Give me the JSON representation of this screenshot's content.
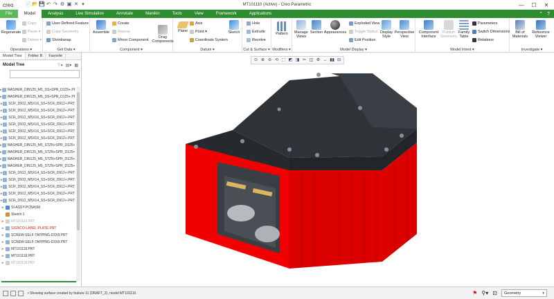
{
  "app": {
    "logo": "creo",
    "window_title": "MT101110 (Active) - Creo Parametric"
  },
  "window_controls": {
    "minimize": "—",
    "maximize": "☐",
    "close": "✕"
  },
  "quick_access": [
    "📄",
    "📂",
    "💾",
    "↶",
    "↷",
    "⚙",
    "▣",
    "✕",
    "▾"
  ],
  "tabs": [
    {
      "label": "File"
    },
    {
      "label": "Model"
    },
    {
      "label": "Analysis"
    },
    {
      "label": "Live Simulation"
    },
    {
      "label": "Annotate"
    },
    {
      "label": "Manikin"
    },
    {
      "label": "Tools"
    },
    {
      "label": "View"
    },
    {
      "label": "Framework"
    },
    {
      "label": "Applications"
    }
  ],
  "ribbon": {
    "operations": {
      "label": "Operations ▾",
      "regenerate": "Regenerate",
      "copy": "Copy",
      "paste": "Paste ▾",
      "delete": "Delete ▾"
    },
    "get_data": {
      "label": "Get Data ▾",
      "user_defined_feature": "User-Defined Feature",
      "copy_geometry": "Copy Geometry",
      "shrinkwrap": "Shrinkwrap"
    },
    "component": {
      "label": "Component ▾",
      "assemble": "Assemble",
      "create": "Create",
      "repeat": "Repeat",
      "mirror_component": "Mirror Component",
      "drag_components": "Drag Components"
    },
    "datum": {
      "label": "Datum ▾",
      "plane": "Plane",
      "axis": "Axis",
      "point": "Point ▾",
      "coordinate_system": "Coordinate System",
      "sketch": "Sketch"
    },
    "cut_surface": {
      "label": "Cut & Surface ▾",
      "hole": "Hole",
      "extrude": "Extrude",
      "revolve": "Revolve"
    },
    "modifiers": {
      "label": "Modifiers ▾",
      "pattern": "Pattern"
    },
    "model_display": {
      "label": "Model Display ▾",
      "manage_views": "Manage Views",
      "section": "Section",
      "appearances": "Appearances",
      "exploded_view": "Exploded View",
      "toggle_status": "Toggle Status",
      "edit_position": "Edit Position",
      "display_style": "Display Style",
      "perspective_view": "Perspective View"
    },
    "model_intent": {
      "label": "Model Intent ▾",
      "component_interface": "Component Interface",
      "publish_geometry": "Publish Geometry",
      "family_table": "Family Table",
      "parameters": "Parameters",
      "switch_dimensions": "Switch Dimensions",
      "relations": "Relations"
    },
    "investigate": {
      "label": "Investigate ▾",
      "bill_of_materials": "Bill of Materials",
      "reference_viewer": "Reference Viewer"
    }
  },
  "left_panel": {
    "tabs": [
      {
        "label": "Model Tree"
      },
      {
        "label": "Folder B"
      },
      {
        "label": "Favorite"
      }
    ],
    "heading": "Model Tree",
    "tree_items": [
      {
        "label": "WASHER_DIN125_M5_SS+SPR_D125+.PR",
        "type": "part"
      },
      {
        "label": "WASHER_DIN125_M5_SS+SPR_D125+.PR",
        "type": "part"
      },
      {
        "label": "SCR_D912_M5X16_SS+SCR_D912+.PRT",
        "type": "part"
      },
      {
        "label": "SCR_D912_M5X16_SS+SCR_D912+.PRT",
        "type": "part"
      },
      {
        "label": "SCR_D912_M5X16_SS+SCR_D912+.PRT",
        "type": "part"
      },
      {
        "label": "SCR_D912_M5X16_SS+SCR_D912+.PRT",
        "type": "part"
      },
      {
        "label": "SCR_D912_M5X16_SS+SCR_D912+.PRT",
        "type": "part"
      },
      {
        "label": "SCR_D912_M5X16_SS+SCR_D912+.PRT",
        "type": "part"
      },
      {
        "label": "WASHER_DIN125_M5_STZN+SPR_D125+",
        "type": "part"
      },
      {
        "label": "WASHER_DIN125_M5_STZN+SPR_D125+",
        "type": "part"
      },
      {
        "label": "WASHER_DIN125_M5_STZN+SPR_D125+",
        "type": "part"
      },
      {
        "label": "WASHER_DIN125_M5_STZN+SPR_D125+",
        "type": "part"
      },
      {
        "label": "SCR_D912_M5X14_SS+SCR_D912+.PRT",
        "type": "part"
      },
      {
        "label": "SCR_D912_M5X14_SS+SCR_D912+.PRT",
        "type": "part"
      },
      {
        "label": "SCR_D912_M5X14_SS+SCR_D912+.PRT",
        "type": "part"
      },
      {
        "label": "SCR_D912_M5X14_SS+SCR_D912+.PRT",
        "type": "part"
      },
      {
        "label": "SCR_D912_M5X14_SS+SCR_D912+.PRT",
        "type": "part"
      },
      {
        "label": "SI-ASSY-PCBASM",
        "type": "asm"
      },
      {
        "label": "Sketch 1",
        "type": "sketch"
      },
      {
        "label": "MT101110.PRT",
        "type": "grey"
      },
      {
        "label": "SIGNCO-LABEL-PLATE.PRT",
        "type": "red"
      },
      {
        "label": "SCREW-SELF-TAPPING-D3X8.PRT",
        "type": "part"
      },
      {
        "label": "SCREW-SELF-TAPPING-D3X8.PRT",
        "type": "part"
      },
      {
        "label": "MT101118.PRT",
        "type": "part"
      },
      {
        "label": "MT101118.PRT",
        "type": "part"
      },
      {
        "label": "MT101118.PRT",
        "type": "grey"
      }
    ]
  },
  "view_toolbar": [
    "⊙",
    "⊕",
    "⊖",
    "⟲",
    "⬚",
    "◩",
    "◨",
    "✂",
    "◫",
    "⚙",
    "↔",
    "▮▮",
    "⊟"
  ],
  "status": {
    "message": "• Showing surface created by feature 11 (DRAFT_2), model MT101110.",
    "filter": "Geometry"
  },
  "colors": {
    "ribbon_green": "#2e8b30",
    "body_red": "#f00000",
    "lid_dark": "#2f3338"
  }
}
